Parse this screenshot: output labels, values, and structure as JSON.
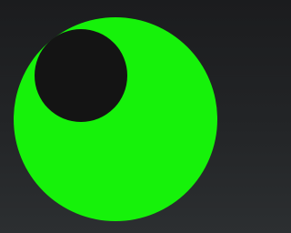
{
  "icon": {
    "name": "green-circle-with-black-hole-icon",
    "colors": {
      "background_top": "#1b1c1e",
      "background_bottom": "#2c2f31",
      "disc": "#16f20a",
      "hole": "#141414"
    }
  }
}
